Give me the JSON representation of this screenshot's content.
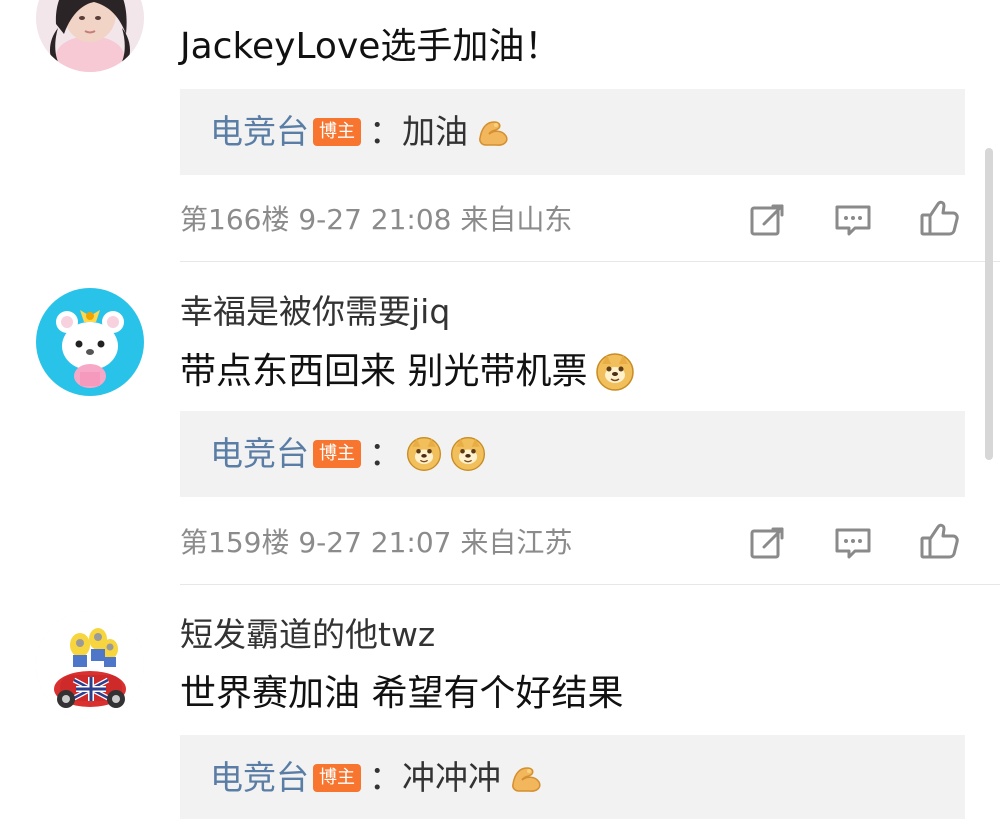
{
  "comments": [
    {
      "text": "JackeyLove选手加油！",
      "reply": {
        "author": "电竞台",
        "badge": "博主",
        "separator": "：",
        "content": "加油"
      },
      "meta": "第166楼 9-27 21:08 来自山东"
    },
    {
      "username": "幸福是被你需要jiq",
      "text": "带点东西回来 别光带机票",
      "reply": {
        "author": "电竞台",
        "badge": "博主",
        "separator": "："
      },
      "meta": "第159楼 9-27 21:07 来自江苏"
    },
    {
      "username": "短发霸道的他twz",
      "text": "世界赛加油 希望有个好结果",
      "reply": {
        "author": "电竞台",
        "badge": "博主",
        "separator": "：",
        "content": "冲冲冲"
      }
    }
  ],
  "icons": {
    "share": "share-icon",
    "comment": "comment-icon",
    "like": "like-icon",
    "emoji_doge": "doge-emoji-icon",
    "emoji_muscle": "muscle-emoji-icon"
  },
  "colors": {
    "reply_author": "#5a7da5",
    "badge": "#f7752f",
    "reply_background": "#f2f2f2",
    "meta_text": "#8b8b8b",
    "divider": "#e7e7e7"
  }
}
